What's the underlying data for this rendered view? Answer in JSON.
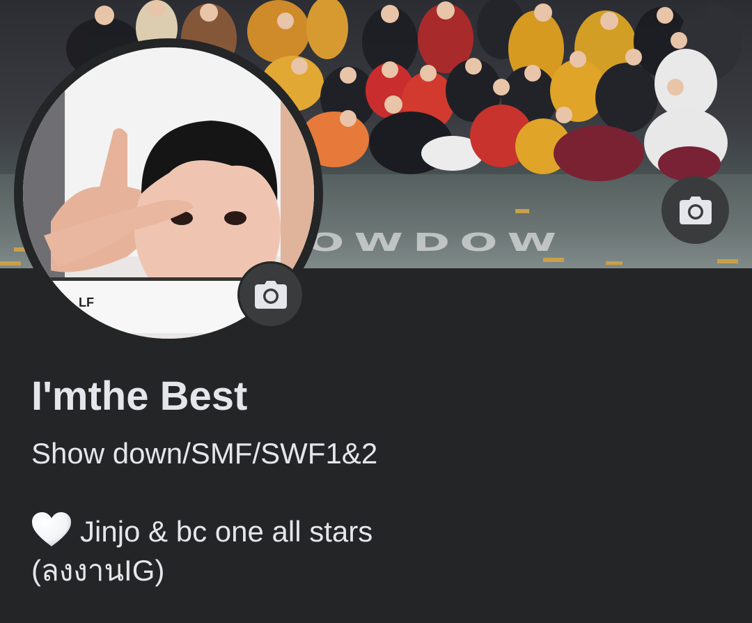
{
  "cover": {
    "stage_text": "OWDOW",
    "camera_icon": "camera-icon"
  },
  "avatar": {
    "camera_icon": "camera-icon"
  },
  "profile": {
    "name": "I'mthe Best",
    "subtitle": "Show down/SMF/SWF1&2",
    "bio": {
      "heart_icon": "white-heart-icon",
      "line1": "Jinjo & bc one all stars",
      "line2": "(ลงงานIG)"
    }
  },
  "colors": {
    "background": "#242526",
    "text": "#e4e6eb",
    "button_bg": "#3a3b3c"
  }
}
